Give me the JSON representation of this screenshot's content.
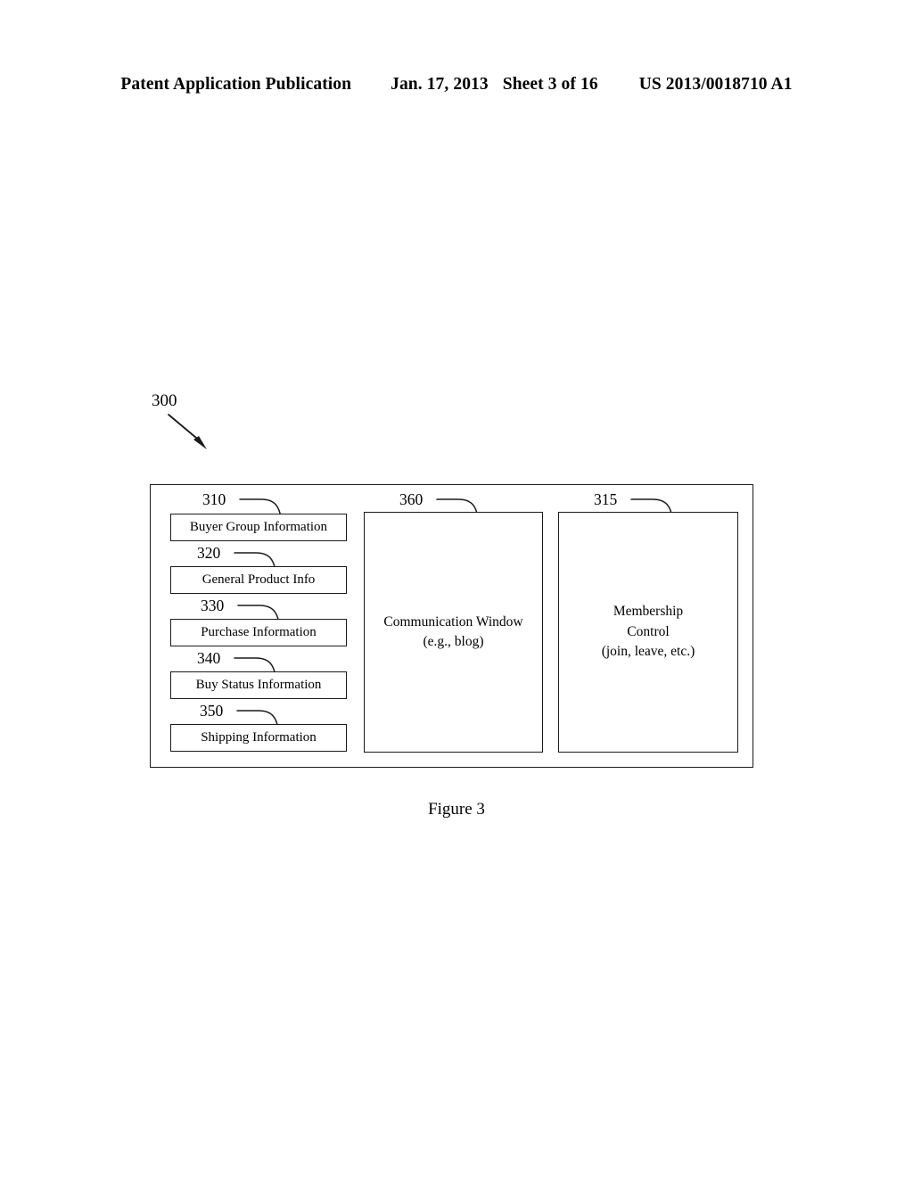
{
  "header": {
    "publication": "Patent Application Publication",
    "date": "Jan. 17, 2013",
    "sheet": "Sheet 3 of 16",
    "patent_number": "US 2013/0018710 A1"
  },
  "figure": {
    "caption": "Figure 3",
    "system_ref": "300",
    "left_column": [
      {
        "ref": "310",
        "label": "Buyer Group Information"
      },
      {
        "ref": "320",
        "label": "General Product Info"
      },
      {
        "ref": "330",
        "label": "Purchase Information"
      },
      {
        "ref": "340",
        "label": "Buy Status Information"
      },
      {
        "ref": "350",
        "label": "Shipping Information"
      }
    ],
    "communication_panel": {
      "ref": "360",
      "line1": "Communication Window",
      "line2": "(e.g., blog)"
    },
    "membership_panel": {
      "ref": "315",
      "line1": "Membership",
      "line2": "Control",
      "line3": "(join, leave, etc.)"
    }
  },
  "colors": {
    "ink": "#1a1a1a",
    "paper": "#ffffff"
  }
}
